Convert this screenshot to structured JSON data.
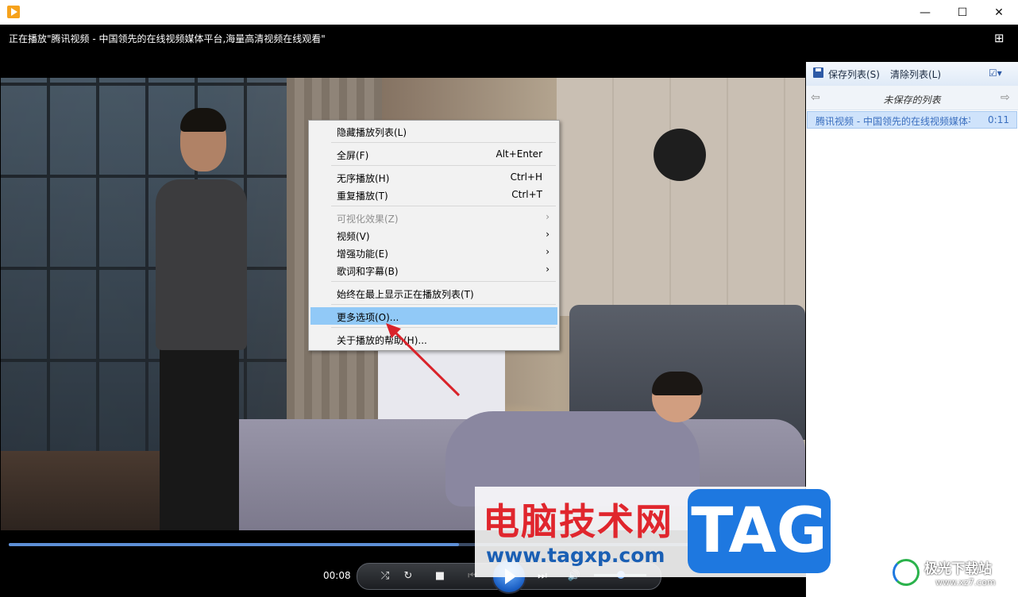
{
  "titlebar": {
    "minimize": "—",
    "maximize": "☐",
    "close": "✕"
  },
  "player": {
    "now_playing": "正在播放\"腾讯视频 - 中国领先的在线视频媒体平台,海量高清视频在线观看\"",
    "current_time": "00:08",
    "seek_progress": 0.45
  },
  "context_menu": {
    "items": [
      {
        "label": "隐藏播放列表(L)",
        "accel": "",
        "submenu": false,
        "disabled": false
      },
      {
        "label": "全屏(F)",
        "accel": "Alt+Enter",
        "submenu": false,
        "disabled": false
      },
      {
        "label": "无序播放(H)",
        "accel": "Ctrl+H",
        "submenu": false,
        "disabled": false
      },
      {
        "label": "重复播放(T)",
        "accel": "Ctrl+T",
        "submenu": false,
        "disabled": false
      },
      {
        "label": "可视化效果(Z)",
        "accel": "",
        "submenu": true,
        "disabled": true
      },
      {
        "label": "视频(V)",
        "accel": "",
        "submenu": true,
        "disabled": false
      },
      {
        "label": "增强功能(E)",
        "accel": "",
        "submenu": true,
        "disabled": false
      },
      {
        "label": "歌词和字幕(B)",
        "accel": "",
        "submenu": true,
        "disabled": false
      },
      {
        "label": "始终在最上显示正在播放列表(T)",
        "accel": "",
        "submenu": false,
        "disabled": false
      },
      {
        "label": "更多选项(O)...",
        "accel": "",
        "submenu": false,
        "disabled": false,
        "highlighted": true
      },
      {
        "label": "关于播放的帮助(H)...",
        "accel": "",
        "submenu": false,
        "disabled": false
      }
    ]
  },
  "playlist": {
    "save_label": "保存列表(S)",
    "clear_label": "清除列表(L)",
    "list_title": "未保存的列表",
    "items": [
      {
        "title": "腾讯视频 - 中国领先的在线视频媒体平台,海量高清视频在线观看",
        "duration": "0:11"
      }
    ]
  },
  "watermark": {
    "site_name": "电脑技术网",
    "site_url": "www.tagxp.com",
    "tag": "TAG",
    "logo_text": "极光下载站",
    "logo_url": "www.xz7.com"
  },
  "colors": {
    "menu_highlight": "#91c9f7",
    "playlist_selection": "#cfe3fb",
    "annotation_arrow": "#d9232a"
  }
}
